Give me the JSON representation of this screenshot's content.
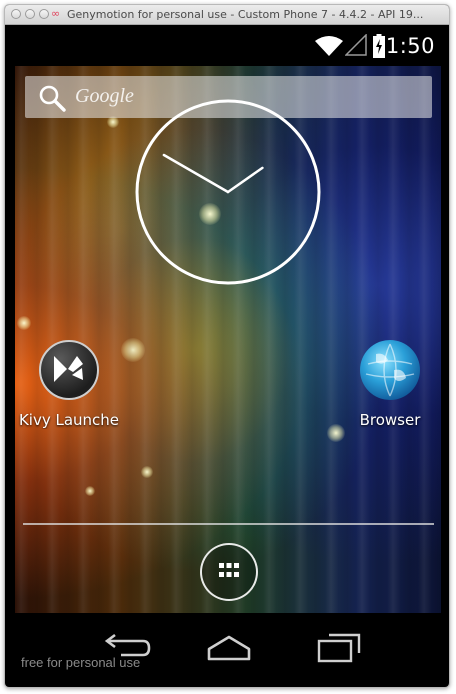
{
  "window": {
    "title": "Genymotion for personal use - Custom Phone 7 - 4.4.2 - API 19..."
  },
  "status_bar": {
    "time": "1:50",
    "icons": [
      "wifi-icon",
      "signal-icon",
      "battery-charging-icon"
    ]
  },
  "search": {
    "label": "Google",
    "icon": "search-icon"
  },
  "clock_widget": {
    "type": "analog",
    "hour": 1,
    "minute": 50
  },
  "home_apps": [
    {
      "label": "Kivy Launche",
      "icon": "kivy-icon"
    },
    {
      "label": "Browser",
      "icon": "globe-icon"
    }
  ],
  "dock": {
    "app_drawer_icon": "grid-icon"
  },
  "nav_bar": {
    "buttons": [
      "back-icon",
      "home-icon",
      "recent-apps-icon"
    ],
    "watermark": "free for personal use"
  },
  "colors": {
    "status_bar": "#000000",
    "nav_bar": "#000000",
    "text": "#ffffff",
    "title_text": "#4a4a4a"
  }
}
